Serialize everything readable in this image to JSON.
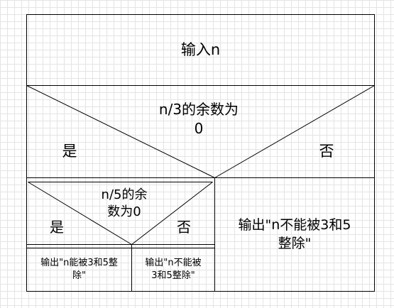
{
  "diagram": {
    "input_label": "输入n",
    "outer_condition": "n/3的余数为\n0",
    "outer_yes": "是",
    "outer_no": "否",
    "inner_condition": "n/5的余\n数为0",
    "inner_yes": "是",
    "inner_no": "否",
    "output_yes": "输出\"n能被3和5整\n除\"",
    "output_partial": "输出\"n不能被\n3和5整除\"",
    "output_no": "输出\"n不能被3和5\n整除\""
  }
}
